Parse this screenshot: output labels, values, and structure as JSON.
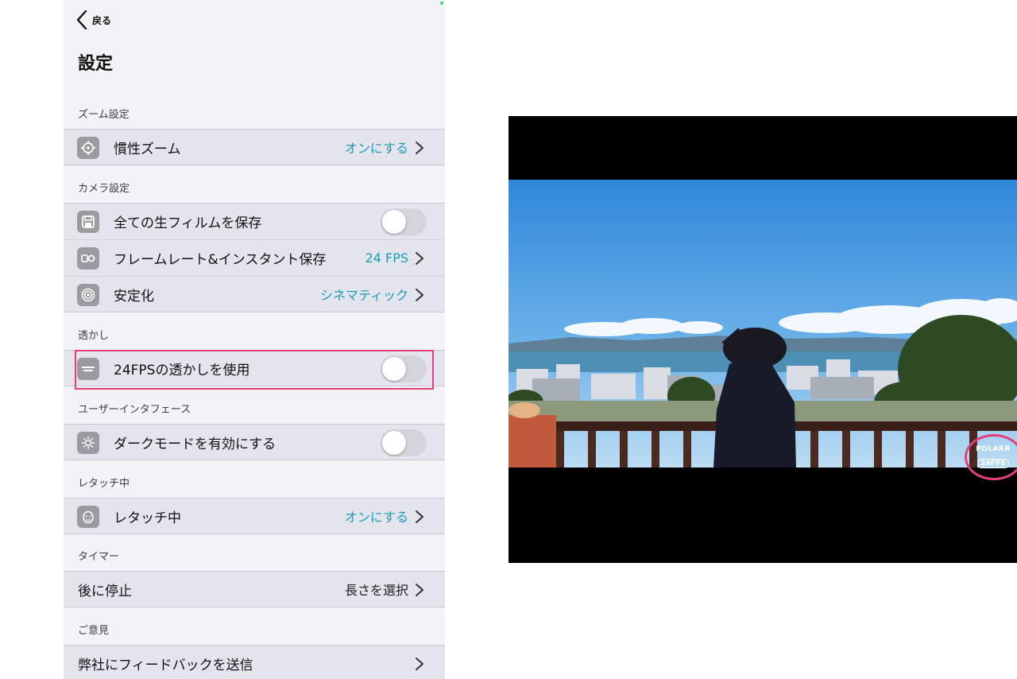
{
  "nav": {
    "back_label": "戻る",
    "title": "設定"
  },
  "sections": {
    "zoom": {
      "header": "ズーム設定",
      "inertia": {
        "label": "慣性ズーム",
        "value": "オンにする",
        "icon": "crosshair-icon"
      }
    },
    "camera": {
      "header": "カメラ設定",
      "save_raw": {
        "label": "全ての生フィルムを保存",
        "icon": "save-icon",
        "toggle": false
      },
      "framerate": {
        "label": "フレームレート&インスタント保存",
        "value": "24 FPS",
        "icon": "framerate-icon"
      },
      "stabilize": {
        "label": "安定化",
        "value": "シネマティック",
        "icon": "stabilization-icon"
      }
    },
    "watermark": {
      "header": "透かし",
      "use": {
        "label": "24FPSの透かしを使用",
        "icon": "watermark-icon",
        "toggle": false
      }
    },
    "ui": {
      "header": "ユーザーインタフェース",
      "dark_mode": {
        "label": "ダークモードを有効にする",
        "icon": "sun-icon",
        "toggle": false
      }
    },
    "retouch": {
      "header": "レタッチ中",
      "retouch": {
        "label": "レタッチ中",
        "value": "オンにする",
        "icon": "face-icon"
      }
    },
    "timer": {
      "header": "タイマー",
      "stop_after": {
        "label": "後に停止",
        "value": "長さを選択"
      }
    },
    "feedback": {
      "header": "ご意見",
      "send": {
        "label": "弊社にフィードバックを送信"
      }
    }
  },
  "preview": {
    "watermark_top": "POLARR",
    "watermark_bottom": "24FPS",
    "highlight_color": "#e3407a"
  },
  "colors": {
    "accent": "#1a9cb8",
    "panel_bg": "#f2f2f7",
    "row_bg": "#e4e4ec"
  }
}
